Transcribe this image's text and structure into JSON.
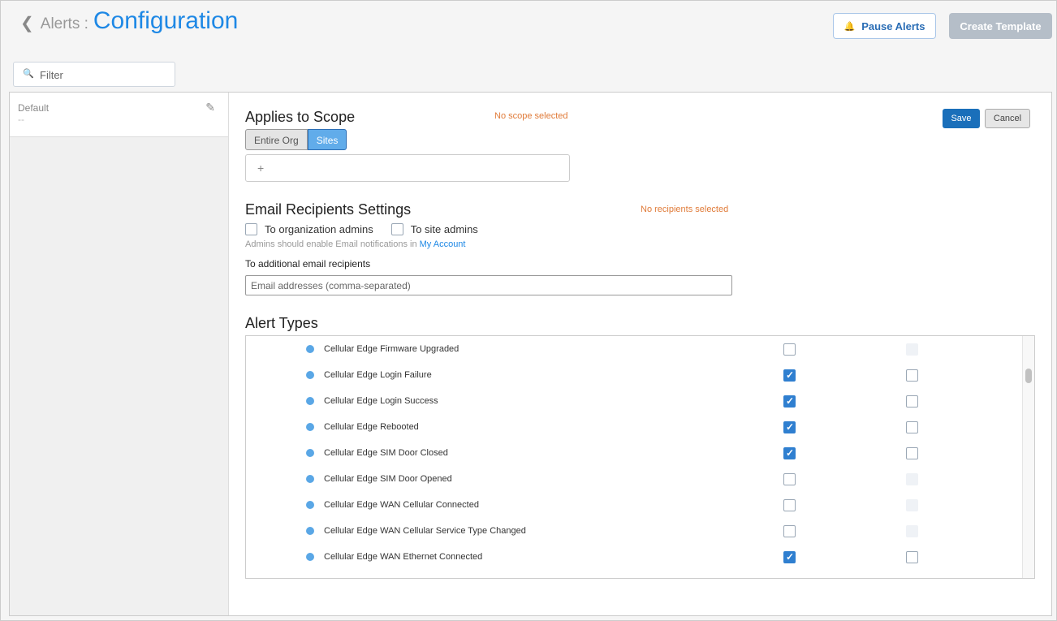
{
  "header": {
    "breadcrumb": "Alerts :",
    "title": "Configuration",
    "pause": "Pause Alerts",
    "create": "Create Template"
  },
  "filter": {
    "placeholder": "Filter"
  },
  "sidebar": {
    "name": "Default",
    "sub": "--"
  },
  "scope": {
    "heading": "Applies to Scope",
    "warning": "No scope selected",
    "options": [
      "Entire Org",
      "Sites"
    ],
    "add": "+"
  },
  "actions": {
    "save": "Save",
    "cancel": "Cancel"
  },
  "email": {
    "heading": "Email Recipients Settings",
    "warning": "No recipients selected",
    "org_admins": "To organization admins",
    "site_admins": "To site admins",
    "note": "Admins should enable Email notifications in",
    "link": "My Account",
    "additional": "To additional email recipients",
    "placeholder": "Email addresses (comma-separated)"
  },
  "alerts": {
    "heading": "Alert Types",
    "items": [
      {
        "name": "Cellular Edge Firmware Upgraded",
        "c1": "off",
        "c2": "dis"
      },
      {
        "name": "Cellular Edge Login Failure",
        "c1": "on",
        "c2": "off"
      },
      {
        "name": "Cellular Edge Login Success",
        "c1": "on",
        "c2": "off"
      },
      {
        "name": "Cellular Edge Rebooted",
        "c1": "on",
        "c2": "off"
      },
      {
        "name": "Cellular Edge SIM Door Closed",
        "c1": "on",
        "c2": "off"
      },
      {
        "name": "Cellular Edge SIM Door Opened",
        "c1": "off",
        "c2": "dis"
      },
      {
        "name": "Cellular Edge WAN Cellular Connected",
        "c1": "off",
        "c2": "dis"
      },
      {
        "name": "Cellular Edge WAN Cellular Service Type Changed",
        "c1": "off",
        "c2": "dis"
      },
      {
        "name": "Cellular Edge WAN Ethernet Connected",
        "c1": "on",
        "c2": "off"
      }
    ]
  }
}
